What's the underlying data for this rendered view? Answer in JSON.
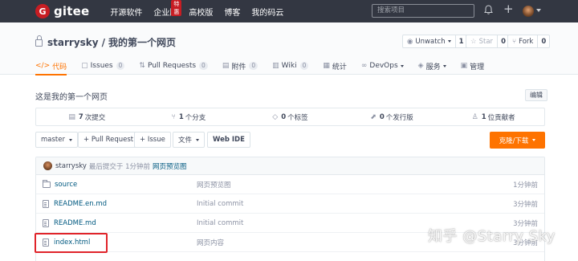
{
  "topnav": {
    "logo_mark": "G",
    "logo_text": "gitee",
    "links": [
      "开源软件",
      "企业版",
      "高校版",
      "博客",
      "我的码云"
    ],
    "hot_badge": "特惠",
    "search_placeholder": "搜索项目",
    "icons": [
      "bell-icon",
      "plus-icon",
      "avatar"
    ]
  },
  "repo": {
    "owner": "starrysky",
    "separator": "/",
    "name": "我的第一个网页",
    "watch": {
      "label": "Unwatch",
      "count": "1"
    },
    "star": {
      "label": "Star",
      "count": "0"
    },
    "fork": {
      "label": "Fork",
      "count": "0"
    }
  },
  "tabs": [
    {
      "label": "代码",
      "icon": "</>"
    },
    {
      "label": "Issues",
      "badge": "0"
    },
    {
      "label": "Pull Requests",
      "badge": "0"
    },
    {
      "label": "附件",
      "badge": "0"
    },
    {
      "label": "Wiki",
      "badge": "0"
    },
    {
      "label": "统计"
    },
    {
      "label": "DevOps"
    },
    {
      "label": "服务"
    },
    {
      "label": "管理"
    }
  ],
  "description": "这是我的第一个网页",
  "edit_label": "编辑",
  "stats": [
    {
      "count": "7",
      "label": "次提交"
    },
    {
      "count": "1",
      "label": "个分支"
    },
    {
      "count": "0",
      "label": "个标签"
    },
    {
      "count": "0",
      "label": "个发行版"
    },
    {
      "count": "1",
      "label": "位贡献者"
    }
  ],
  "toolbar": {
    "branch": "master",
    "pull_request": "+ Pull Request",
    "issue": "+ Issue",
    "file": "文件",
    "webide": "Web IDE",
    "clone": "克隆/下载"
  },
  "commit": {
    "author": "starrysky",
    "meta": "最后提交于 1分钟前",
    "message": "网页预览图"
  },
  "files": [
    {
      "name": "source",
      "type": "folder",
      "message": "网页预览图",
      "time": "1分钟前"
    },
    {
      "name": "README.en.md",
      "type": "file",
      "message": "Initial commit",
      "time": "3分钟前"
    },
    {
      "name": "README.md",
      "type": "file",
      "message": "Initial commit",
      "time": "3分钟前"
    },
    {
      "name": "index.html",
      "type": "file",
      "message": "网页内容",
      "time": "3分钟前"
    }
  ],
  "watermark": "知乎 @Starry Sky",
  "colors": {
    "accent": "#fe7300",
    "nav_bg": "#333742",
    "brand_red": "#c71d23",
    "highlight": "#e0242a"
  }
}
